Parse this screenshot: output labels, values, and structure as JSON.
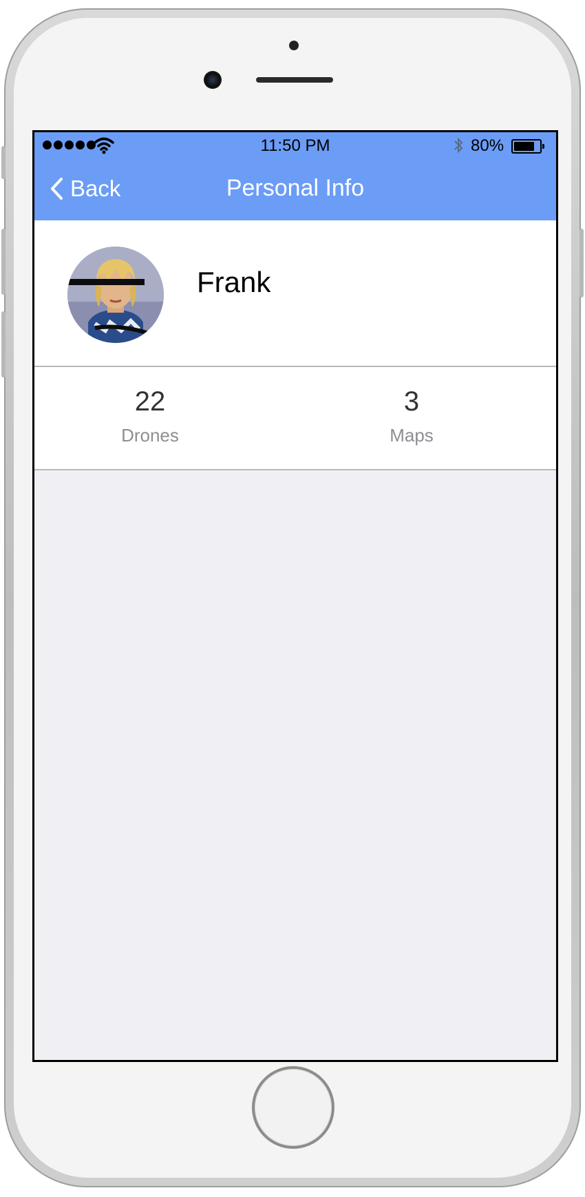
{
  "status_bar": {
    "time": "11:50 PM",
    "battery_percent": "80%",
    "battery_level": 0.8
  },
  "nav": {
    "back_label": "Back",
    "title": "Personal Info"
  },
  "profile": {
    "name": "Frank"
  },
  "stats": [
    {
      "value": "22",
      "label": "Drones"
    },
    {
      "value": "3",
      "label": "Maps"
    }
  ],
  "colors": {
    "header": "#6b9cf6",
    "content_background": "#efeff4"
  }
}
